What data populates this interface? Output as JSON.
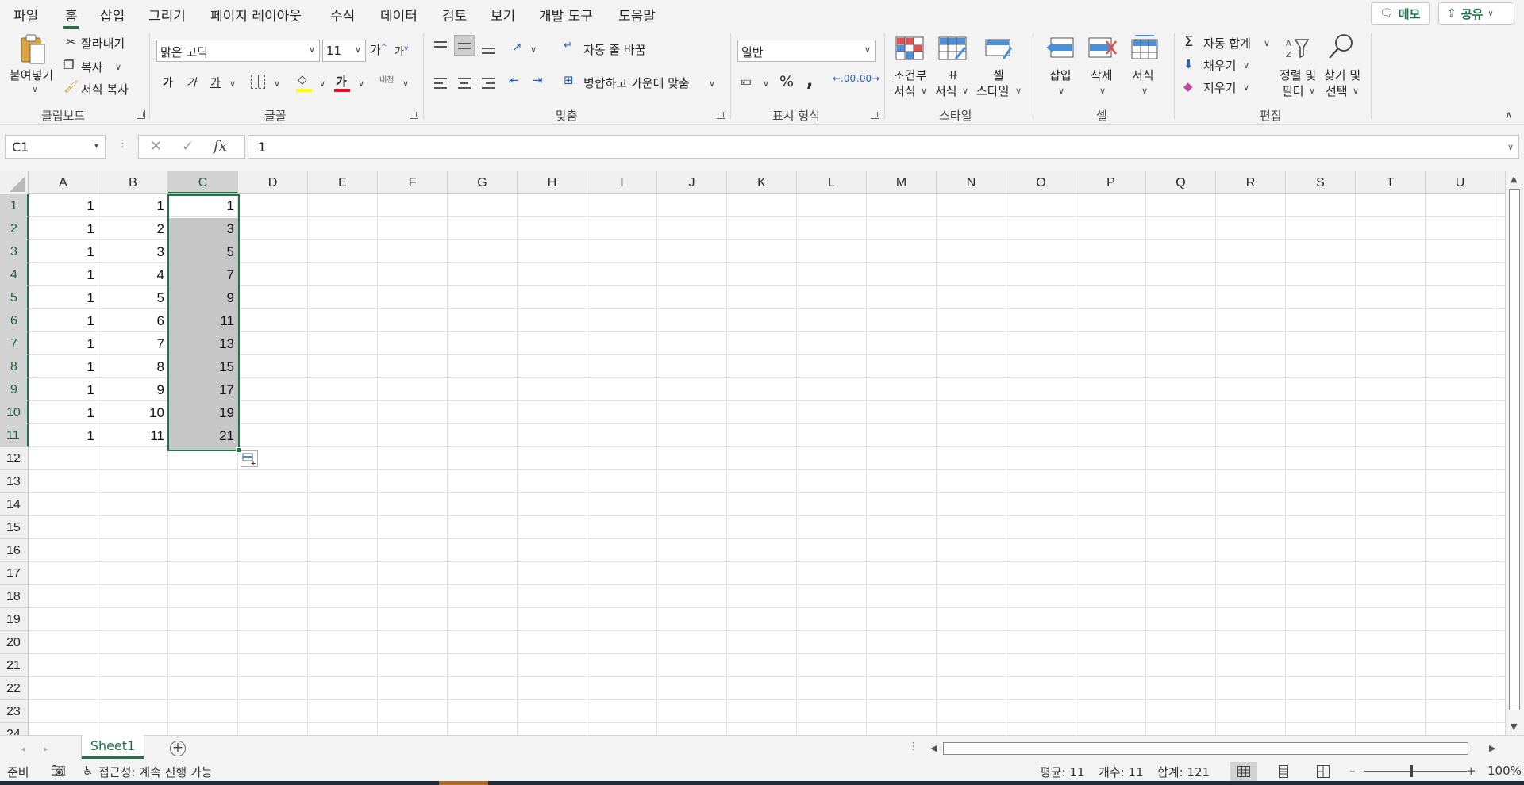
{
  "menu": {
    "items": [
      "파일",
      "홈",
      "삽입",
      "그리기",
      "페이지 레이아웃",
      "수식",
      "데이터",
      "검토",
      "보기",
      "개발 도구",
      "도움말"
    ],
    "active": "홈",
    "memo_label": "메모",
    "share_label": "공유"
  },
  "ribbon": {
    "clipboard": {
      "paste": "붙여넣기",
      "cut": "잘라내기",
      "copy": "복사",
      "format_painter": "서식 복사",
      "label": "클립보드"
    },
    "font": {
      "name": "맑은 고딕",
      "size": "11",
      "grow": "가",
      "shrink": "가",
      "bold": "가",
      "italic": "가",
      "underline": "가",
      "font_color_glyph": "가",
      "phonetic": "내천",
      "label": "글꼴",
      "highlight_color": "#ffff00",
      "font_color": "#e81123"
    },
    "alignment": {
      "wrap_text": "자동 줄 바꿈",
      "merge_center": "병합하고 가운데 맞춤",
      "label": "맞춤"
    },
    "number": {
      "format": "일반",
      "label": "표시 형식"
    },
    "styles": {
      "conditional_top": "조건부",
      "conditional_bottom": "서식",
      "table_top": "표",
      "table_bottom": "서식",
      "cell_top": "셀",
      "cell_bottom": "스타일",
      "label": "스타일"
    },
    "cells": {
      "insert": "삽입",
      "delete": "삭제",
      "format": "서식",
      "label": "셀"
    },
    "editing": {
      "autosum": "자동 합계",
      "fill": "채우기",
      "clear": "지우기",
      "sort_top": "정렬 및",
      "sort_bottom": "필터",
      "find_top": "찾기 및",
      "find_bottom": "선택",
      "label": "편집"
    }
  },
  "formula_bar": {
    "name_box": "C1",
    "fx": "fx",
    "content": "1"
  },
  "grid": {
    "columns": [
      "A",
      "B",
      "C",
      "D",
      "E",
      "F",
      "G",
      "H",
      "I",
      "J",
      "K",
      "L",
      "M",
      "N",
      "O",
      "P",
      "Q",
      "R",
      "S",
      "T",
      "U"
    ],
    "row_numbers": [
      "1",
      "2",
      "3",
      "4",
      "5",
      "6",
      "7",
      "8",
      "9",
      "10",
      "11",
      "12",
      "13",
      "14",
      "15",
      "16",
      "17",
      "18",
      "19",
      "20",
      "21",
      "22",
      "23",
      "24"
    ],
    "selected_column": "C",
    "selected_rows": [
      "1",
      "2",
      "3",
      "4",
      "5",
      "6",
      "7",
      "8",
      "9",
      "10",
      "11"
    ],
    "data": [
      [
        "1",
        "1",
        "1"
      ],
      [
        "1",
        "2",
        "3"
      ],
      [
        "1",
        "3",
        "5"
      ],
      [
        "1",
        "4",
        "7"
      ],
      [
        "1",
        "5",
        "9"
      ],
      [
        "1",
        "6",
        "11"
      ],
      [
        "1",
        "7",
        "13"
      ],
      [
        "1",
        "8",
        "15"
      ],
      [
        "1",
        "9",
        "17"
      ],
      [
        "1",
        "10",
        "19"
      ],
      [
        "1",
        "11",
        "21"
      ]
    ]
  },
  "sheets": {
    "tabs": [
      "Sheet1"
    ],
    "active": "Sheet1"
  },
  "status": {
    "ready": "준비",
    "accessibility": "접근성: 계속 진행 가능",
    "average": "평균: 11",
    "count": "개수: 11",
    "sum": "합계: 121",
    "zoom": "100%"
  },
  "colors": {
    "accent": "#217346",
    "selection_fill": "#c6c6c6"
  }
}
